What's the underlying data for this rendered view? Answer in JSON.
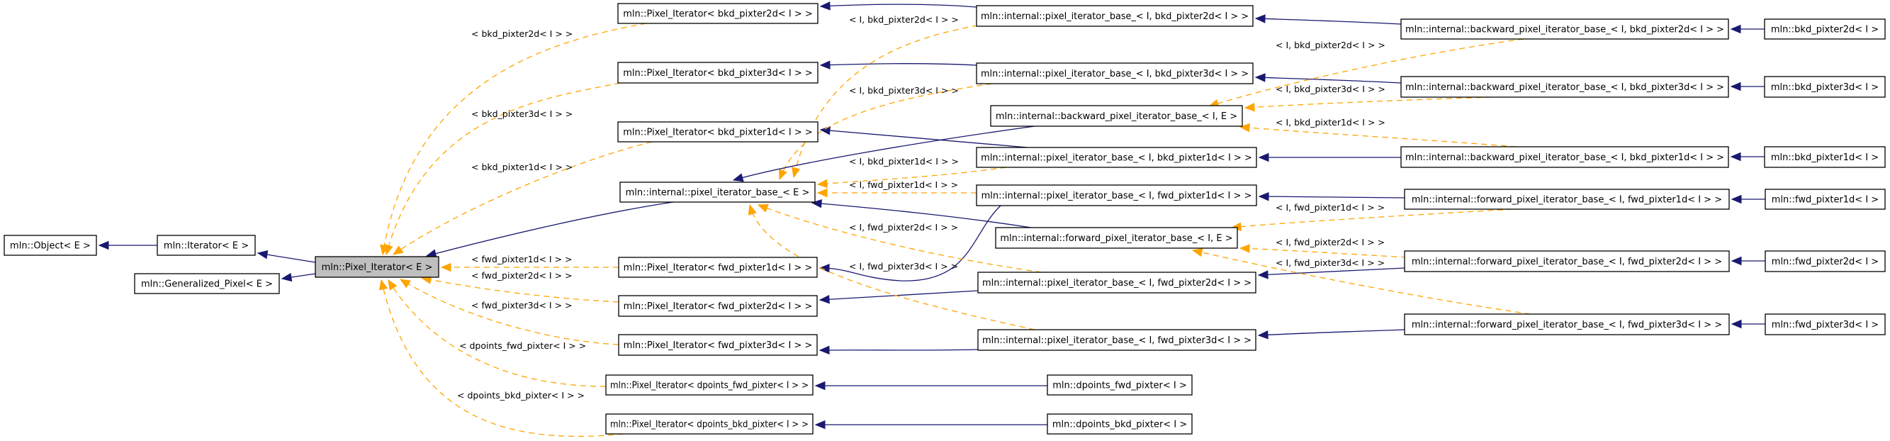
{
  "diagram": {
    "type": "class inheritance graph",
    "colors": {
      "inherit_edge": "#191970",
      "template_edge": "#ffa500",
      "highlight_node_fill": "#bfbfbf",
      "node_fill": "#ffffff",
      "node_border": "#000000"
    },
    "nodes": [
      {
        "id": "object",
        "label": "mln::Object< E >"
      },
      {
        "id": "iterator",
        "label": "mln::Iterator< E >"
      },
      {
        "id": "generalized_pixel",
        "label": "mln::Generalized_Pixel< E >"
      },
      {
        "id": "pixel_iterator",
        "label": "mln::Pixel_Iterator< E >",
        "highlighted": true
      },
      {
        "id": "pi_bkd2d",
        "label": "mln::Pixel_Iterator< bkd_pixter2d< I > >"
      },
      {
        "id": "pi_bkd3d",
        "label": "mln::Pixel_Iterator< bkd_pixter3d< I > >"
      },
      {
        "id": "pi_bkd1d",
        "label": "mln::Pixel_Iterator< bkd_pixter1d< I > >"
      },
      {
        "id": "pib_e",
        "label": "mln::internal::pixel_iterator_base_< E >"
      },
      {
        "id": "pi_fwd1d",
        "label": "mln::Pixel_Iterator< fwd_pixter1d< I > >"
      },
      {
        "id": "pi_fwd2d",
        "label": "mln::Pixel_Iterator< fwd_pixter2d< I > >"
      },
      {
        "id": "pi_fwd3d",
        "label": "mln::Pixel_Iterator< fwd_pixter3d< I > >"
      },
      {
        "id": "pi_dfwd",
        "label": "mln::Pixel_Iterator< dpoints_fwd_pixter< I > >"
      },
      {
        "id": "pi_dbkd",
        "label": "mln::Pixel_Iterator< dpoints_bkd_pixter< I > >"
      },
      {
        "id": "pib_bkd2d",
        "label": "mln::internal::pixel_iterator_base_< I, bkd_pixter2d< I > >"
      },
      {
        "id": "pib_bkd3d",
        "label": "mln::internal::pixel_iterator_base_< I, bkd_pixter3d< I > >"
      },
      {
        "id": "bpib_ie",
        "label": "mln::internal::backward_pixel_iterator_base_< I, E >"
      },
      {
        "id": "pib_bkd1d",
        "label": "mln::internal::pixel_iterator_base_< I, bkd_pixter1d< I > >"
      },
      {
        "id": "pib_fwd1d",
        "label": "mln::internal::pixel_iterator_base_< I, fwd_pixter1d< I > >"
      },
      {
        "id": "fpib_ie",
        "label": "mln::internal::forward_pixel_iterator_base_< I, E >"
      },
      {
        "id": "pib_fwd2d",
        "label": "mln::internal::pixel_iterator_base_< I, fwd_pixter2d< I > >"
      },
      {
        "id": "pib_fwd3d",
        "label": "mln::internal::pixel_iterator_base_< I, fwd_pixter3d< I > >"
      },
      {
        "id": "dfwd",
        "label": "mln::dpoints_fwd_pixter< I >"
      },
      {
        "id": "dbkd",
        "label": "mln::dpoints_bkd_pixter< I >"
      },
      {
        "id": "bpib_bkd2d",
        "label": "mln::internal::backward_pixel_iterator_base_< I, bkd_pixter2d< I > >"
      },
      {
        "id": "bpib_bkd3d",
        "label": "mln::internal::backward_pixel_iterator_base_< I, bkd_pixter3d< I > >"
      },
      {
        "id": "bpib_bkd1d",
        "label": "mln::internal::backward_pixel_iterator_base_< I, bkd_pixter1d< I > >"
      },
      {
        "id": "fpib_fwd1d",
        "label": "mln::internal::forward_pixel_iterator_base_< I, fwd_pixter1d< I > >"
      },
      {
        "id": "fpib_fwd2d",
        "label": "mln::internal::forward_pixel_iterator_base_< I, fwd_pixter2d< I > >"
      },
      {
        "id": "fpib_fwd3d",
        "label": "mln::internal::forward_pixel_iterator_base_< I, fwd_pixter3d< I > >"
      },
      {
        "id": "bkd2d",
        "label": "mln::bkd_pixter2d< I >"
      },
      {
        "id": "bkd3d",
        "label": "mln::bkd_pixter3d< I >"
      },
      {
        "id": "bkd1d",
        "label": "mln::bkd_pixter1d< I >"
      },
      {
        "id": "fwd1d",
        "label": "mln::fwd_pixter1d< I >"
      },
      {
        "id": "fwd2d",
        "label": "mln::fwd_pixter2d< I >"
      },
      {
        "id": "fwd3d",
        "label": "mln::fwd_pixter3d< I >"
      }
    ],
    "edges": [
      {
        "from": "iterator",
        "to": "object",
        "kind": "inherit"
      },
      {
        "from": "pixel_iterator",
        "to": "iterator",
        "kind": "inherit"
      },
      {
        "from": "pixel_iterator",
        "to": "generalized_pixel",
        "kind": "inherit"
      },
      {
        "from": "pib_e",
        "to": "pixel_iterator",
        "kind": "inherit"
      },
      {
        "from": "pi_bkd2d",
        "to": "pixel_iterator",
        "kind": "template",
        "label": "< bkd_pixter2d< I > >"
      },
      {
        "from": "pi_bkd3d",
        "to": "pixel_iterator",
        "kind": "template",
        "label": "< bkd_pixter3d< I > >"
      },
      {
        "from": "pi_bkd1d",
        "to": "pixel_iterator",
        "kind": "template",
        "label": "< bkd_pixter1d< I > >"
      },
      {
        "from": "pi_fwd1d",
        "to": "pixel_iterator",
        "kind": "template",
        "label": "< fwd_pixter1d< I > >"
      },
      {
        "from": "pi_fwd2d",
        "to": "pixel_iterator",
        "kind": "template",
        "label": "< fwd_pixter2d< I > >"
      },
      {
        "from": "pi_fwd3d",
        "to": "pixel_iterator",
        "kind": "template",
        "label": "< fwd_pixter3d< I > >"
      },
      {
        "from": "pi_dfwd",
        "to": "pixel_iterator",
        "kind": "template",
        "label": "< dpoints_fwd_pixter< I > >"
      },
      {
        "from": "pi_dbkd",
        "to": "pixel_iterator",
        "kind": "template",
        "label": "< dpoints_bkd_pixter< I > >"
      },
      {
        "from": "pib_bkd2d",
        "to": "pi_bkd2d",
        "kind": "inherit"
      },
      {
        "from": "pib_bkd3d",
        "to": "pi_bkd3d",
        "kind": "inherit"
      },
      {
        "from": "pib_bkd1d",
        "to": "pi_bkd1d",
        "kind": "inherit"
      },
      {
        "from": "pib_fwd1d",
        "to": "pi_fwd1d",
        "kind": "inherit"
      },
      {
        "from": "pib_fwd2d",
        "to": "pi_fwd2d",
        "kind": "inherit"
      },
      {
        "from": "pib_fwd3d",
        "to": "pi_fwd3d",
        "kind": "inherit"
      },
      {
        "from": "dfwd",
        "to": "pi_dfwd",
        "kind": "inherit"
      },
      {
        "from": "dbkd",
        "to": "pi_dbkd",
        "kind": "inherit"
      },
      {
        "from": "pib_bkd2d",
        "to": "pib_e",
        "kind": "template",
        "label": "< I, bkd_pixter2d< I > >"
      },
      {
        "from": "pib_bkd3d",
        "to": "pib_e",
        "kind": "template",
        "label": "< I, bkd_pixter3d< I > >"
      },
      {
        "from": "pib_bkd1d",
        "to": "pib_e",
        "kind": "template",
        "label": "< I, bkd_pixter1d< I > >"
      },
      {
        "from": "pib_fwd1d",
        "to": "pib_e",
        "kind": "template",
        "label": "< I, fwd_pixter1d< I > >"
      },
      {
        "from": "pib_fwd2d",
        "to": "pib_e",
        "kind": "template",
        "label": "< I, fwd_pixter2d< I > >"
      },
      {
        "from": "pib_fwd3d",
        "to": "pib_e",
        "kind": "template",
        "label": "< I, fwd_pixter3d< I > >"
      },
      {
        "from": "bpib_ie",
        "to": "pib_e",
        "kind": "inherit"
      },
      {
        "from": "fpib_ie",
        "to": "pib_e",
        "kind": "inherit"
      },
      {
        "from": "bpib_bkd2d",
        "to": "pib_bkd2d",
        "kind": "inherit"
      },
      {
        "from": "bpib_bkd3d",
        "to": "pib_bkd3d",
        "kind": "inherit"
      },
      {
        "from": "bpib_bkd1d",
        "to": "pib_bkd1d",
        "kind": "inherit"
      },
      {
        "from": "fpib_fwd1d",
        "to": "pib_fwd1d",
        "kind": "inherit"
      },
      {
        "from": "fpib_fwd2d",
        "to": "pib_fwd2d",
        "kind": "inherit"
      },
      {
        "from": "fpib_fwd3d",
        "to": "pib_fwd3d",
        "kind": "inherit"
      },
      {
        "from": "bpib_bkd2d",
        "to": "bpib_ie",
        "kind": "template",
        "label": "< I, bkd_pixter2d< I > >"
      },
      {
        "from": "bpib_bkd3d",
        "to": "bpib_ie",
        "kind": "template",
        "label": "< I, bkd_pixter3d< I > >"
      },
      {
        "from": "bpib_bkd1d",
        "to": "bpib_ie",
        "kind": "template",
        "label": "< I, bkd_pixter1d< I > >"
      },
      {
        "from": "fpib_fwd1d",
        "to": "fpib_ie",
        "kind": "template",
        "label": "< I, fwd_pixter1d< I > >"
      },
      {
        "from": "fpib_fwd2d",
        "to": "fpib_ie",
        "kind": "template",
        "label": "< I, fwd_pixter2d< I > >"
      },
      {
        "from": "fpib_fwd3d",
        "to": "fpib_ie",
        "kind": "template",
        "label": "< I, fwd_pixter3d< I > >"
      },
      {
        "from": "bkd2d",
        "to": "bpib_bkd2d",
        "kind": "inherit"
      },
      {
        "from": "bkd3d",
        "to": "bpib_bkd3d",
        "kind": "inherit"
      },
      {
        "from": "bkd1d",
        "to": "bpib_bkd1d",
        "kind": "inherit"
      },
      {
        "from": "fwd1d",
        "to": "fpib_fwd1d",
        "kind": "inherit"
      },
      {
        "from": "fwd2d",
        "to": "fpib_fwd2d",
        "kind": "inherit"
      },
      {
        "from": "fwd3d",
        "to": "fpib_fwd3d",
        "kind": "inherit"
      }
    ]
  }
}
